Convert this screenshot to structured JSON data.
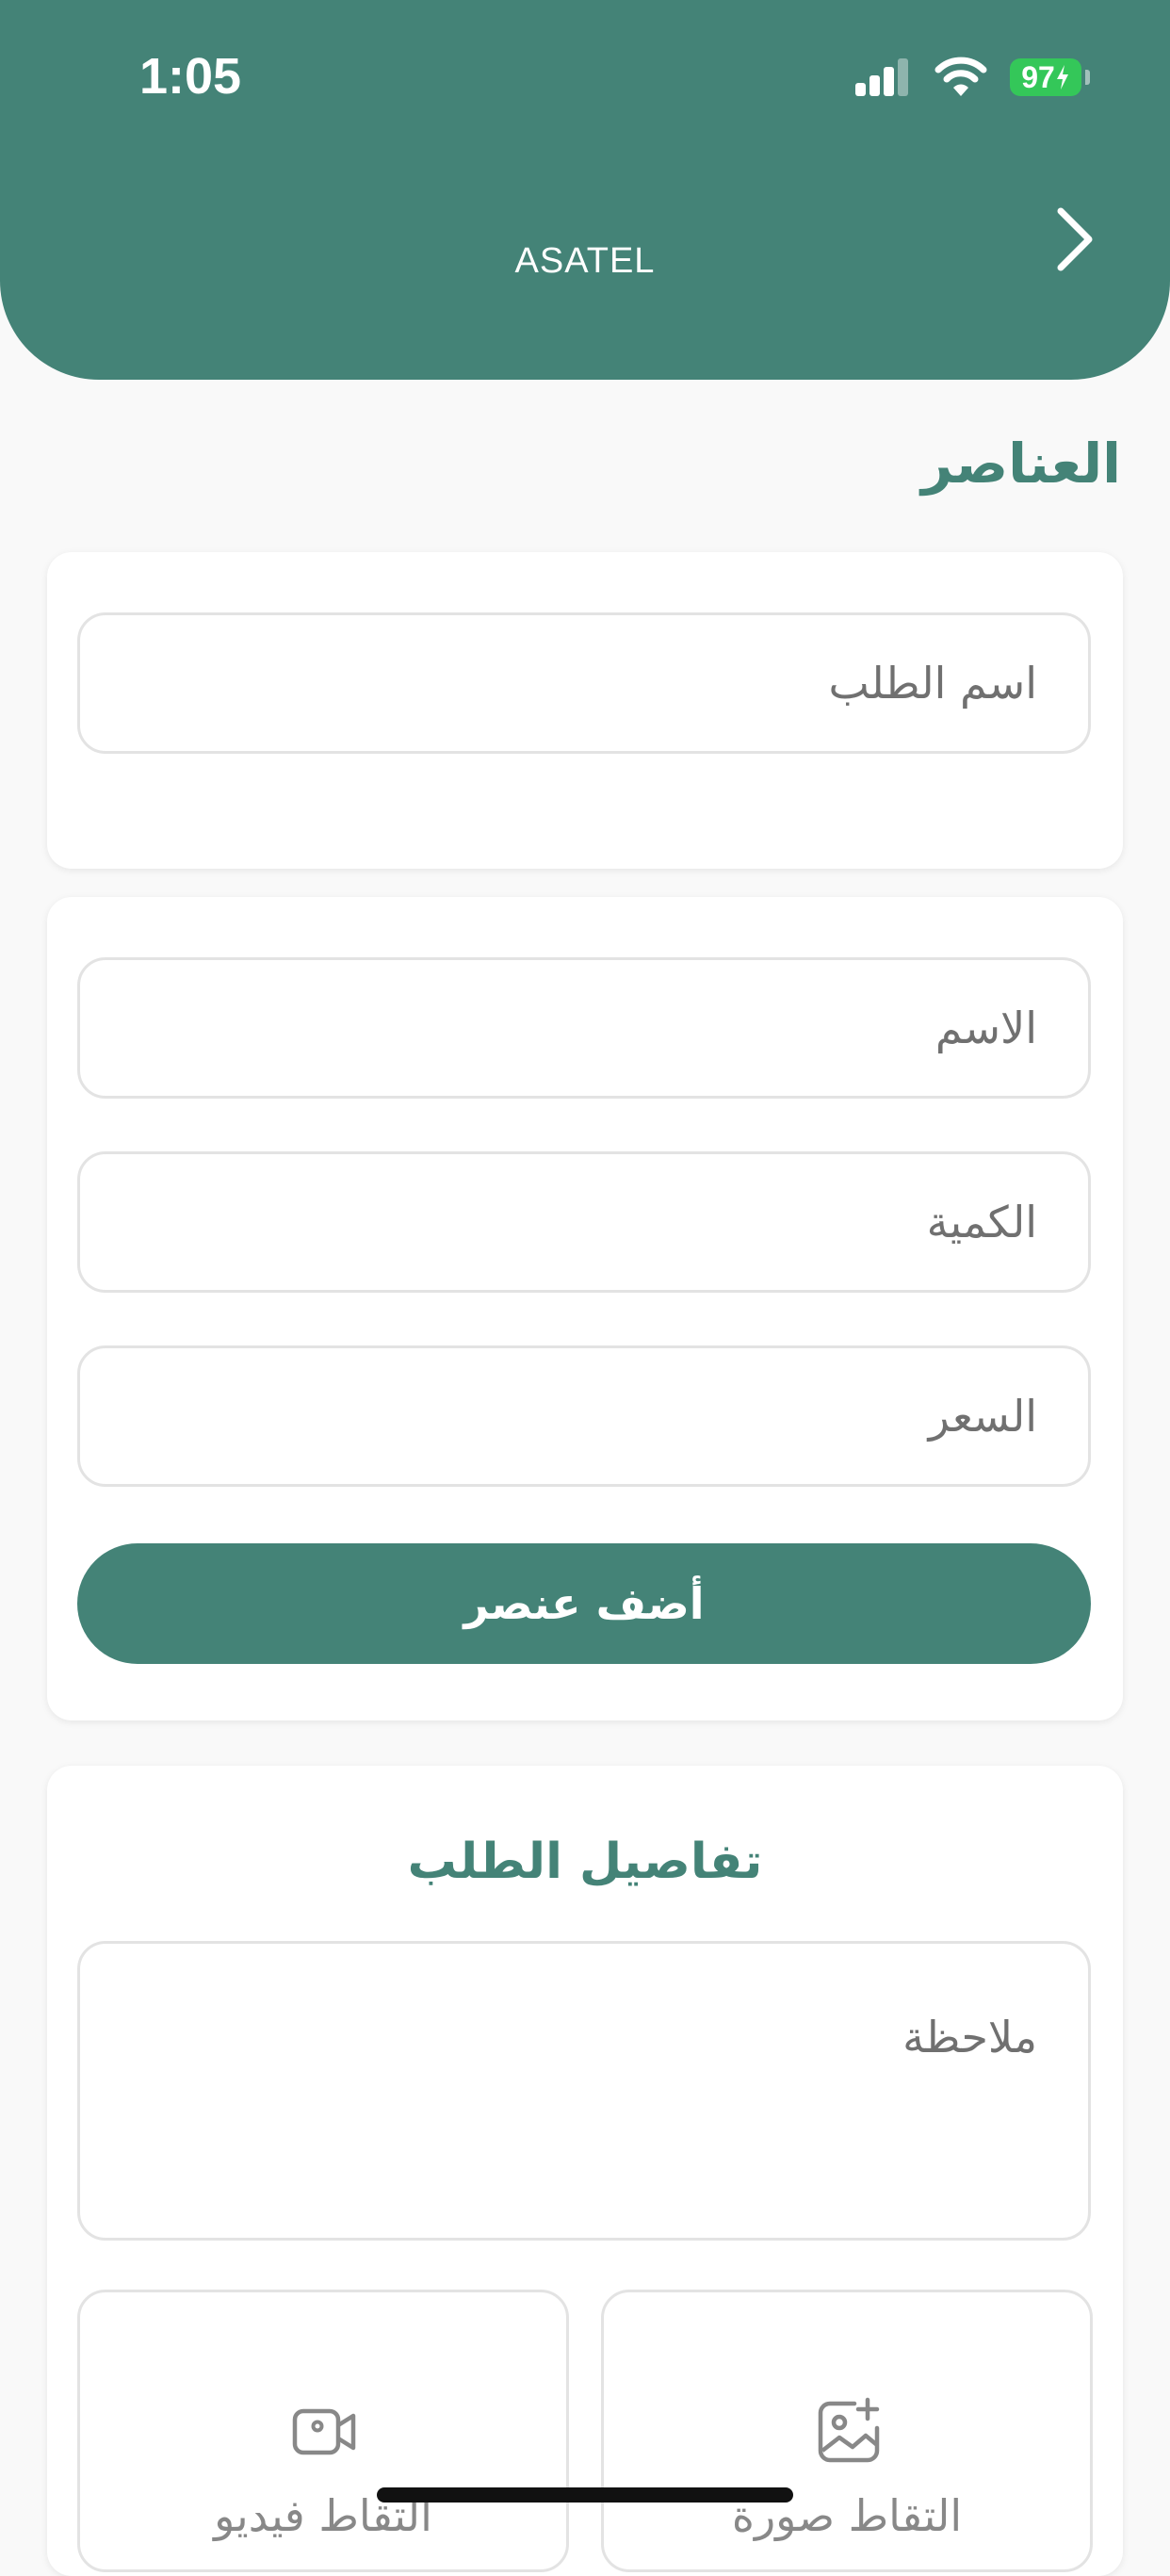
{
  "status_bar": {
    "time": "1:05",
    "battery": "97"
  },
  "header": {
    "title": "ASATEL"
  },
  "section_title": "العناصر",
  "order_name_placeholder": "اسم الطلب",
  "item_form": {
    "name_placeholder": "الاسم",
    "quantity_placeholder": "الكمية",
    "price_placeholder": "السعر",
    "add_button": "أضف عنصر"
  },
  "details": {
    "title": "تفاصيل الطلب",
    "note_placeholder": "ملاحظة",
    "capture_photo": "التقاط صورة",
    "capture_video": "التقاط فيديو"
  },
  "colors": {
    "primary": "#448377",
    "battery": "#34c759"
  },
  "icons": [
    "chevron-right-icon",
    "image-add-icon",
    "video-camera-icon"
  ]
}
